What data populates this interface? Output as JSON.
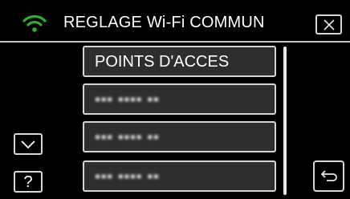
{
  "header": {
    "title": "REGLAGE Wi-Fi COMMUN",
    "wifi_icon": "wifi-signal-icon",
    "wifi_color": "#2fae2f",
    "close_icon": "close-icon"
  },
  "list": {
    "items": [
      {
        "label": "POINTS D'ACCES"
      },
      {
        "label": "▪▪▪ ▪▪▪▪ ▪▪"
      },
      {
        "label": "▪▪▪ ▪▪▪▪ ▪▪"
      },
      {
        "label": "▪▪▪ ▪▪▪▪ ▪▪"
      }
    ]
  },
  "controls": {
    "scroll_down_icon": "chevron-down-icon",
    "help_label": "?",
    "back_icon": "return-arrow-icon"
  }
}
